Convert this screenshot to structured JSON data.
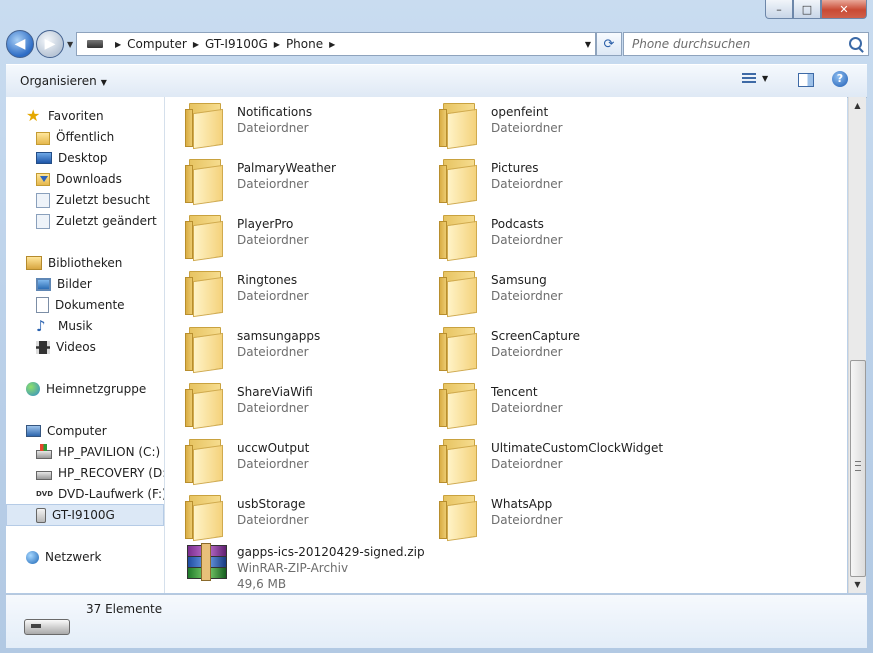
{
  "window": {
    "minimize": "–",
    "maximize": "□",
    "close": "✕"
  },
  "nav": {
    "back": "◀",
    "forward": "▶",
    "address": {
      "crumbs": [
        "Computer",
        "GT-I9100G",
        "Phone"
      ]
    },
    "search_placeholder": "Phone durchsuchen"
  },
  "command_bar": {
    "organize": "Organisieren",
    "help": "?"
  },
  "sidebar": {
    "favorites": {
      "label": "Favoriten",
      "items": [
        "Öffentlich",
        "Desktop",
        "Downloads",
        "Zuletzt besucht",
        "Zuletzt geändert"
      ]
    },
    "libraries": {
      "label": "Bibliotheken",
      "items": [
        "Bilder",
        "Dokumente",
        "Musik",
        "Videos"
      ]
    },
    "homegroup": "Heimnetzgruppe",
    "computer": {
      "label": "Computer",
      "items": [
        "HP_PAVILION (C:)",
        "HP_RECOVERY (D:)",
        "DVD-Laufwerk (F:) A",
        "GT-I9100G"
      ],
      "selected": "GT-I9100G"
    },
    "network": "Netzwerk"
  },
  "files": {
    "left": [
      {
        "name": "Notifications",
        "type": "Dateiordner"
      },
      {
        "name": "PalmaryWeather",
        "type": "Dateiordner"
      },
      {
        "name": "PlayerPro",
        "type": "Dateiordner"
      },
      {
        "name": "Ringtones",
        "type": "Dateiordner"
      },
      {
        "name": "samsungapps",
        "type": "Dateiordner"
      },
      {
        "name": "ShareViaWifi",
        "type": "Dateiordner"
      },
      {
        "name": "uccwOutput",
        "type": "Dateiordner"
      },
      {
        "name": "usbStorage",
        "type": "Dateiordner"
      }
    ],
    "right": [
      {
        "name": "openfeint",
        "type": "Dateiordner"
      },
      {
        "name": "Pictures",
        "type": "Dateiordner"
      },
      {
        "name": "Podcasts",
        "type": "Dateiordner"
      },
      {
        "name": "Samsung",
        "type": "Dateiordner"
      },
      {
        "name": "ScreenCapture",
        "type": "Dateiordner"
      },
      {
        "name": "Tencent",
        "type": "Dateiordner"
      },
      {
        "name": "UltimateCustomClockWidget",
        "type": "Dateiordner"
      },
      {
        "name": "WhatsApp",
        "type": "Dateiordner"
      }
    ],
    "archive": {
      "name": "gapps-ics-20120429-signed.zip",
      "type": "WinRAR-ZIP-Archiv",
      "size": "49,6 MB"
    }
  },
  "scrollbar": {
    "up": "▲",
    "down": "▼",
    "thumb_position": 0.57
  },
  "details": {
    "count": "37 Elemente"
  }
}
